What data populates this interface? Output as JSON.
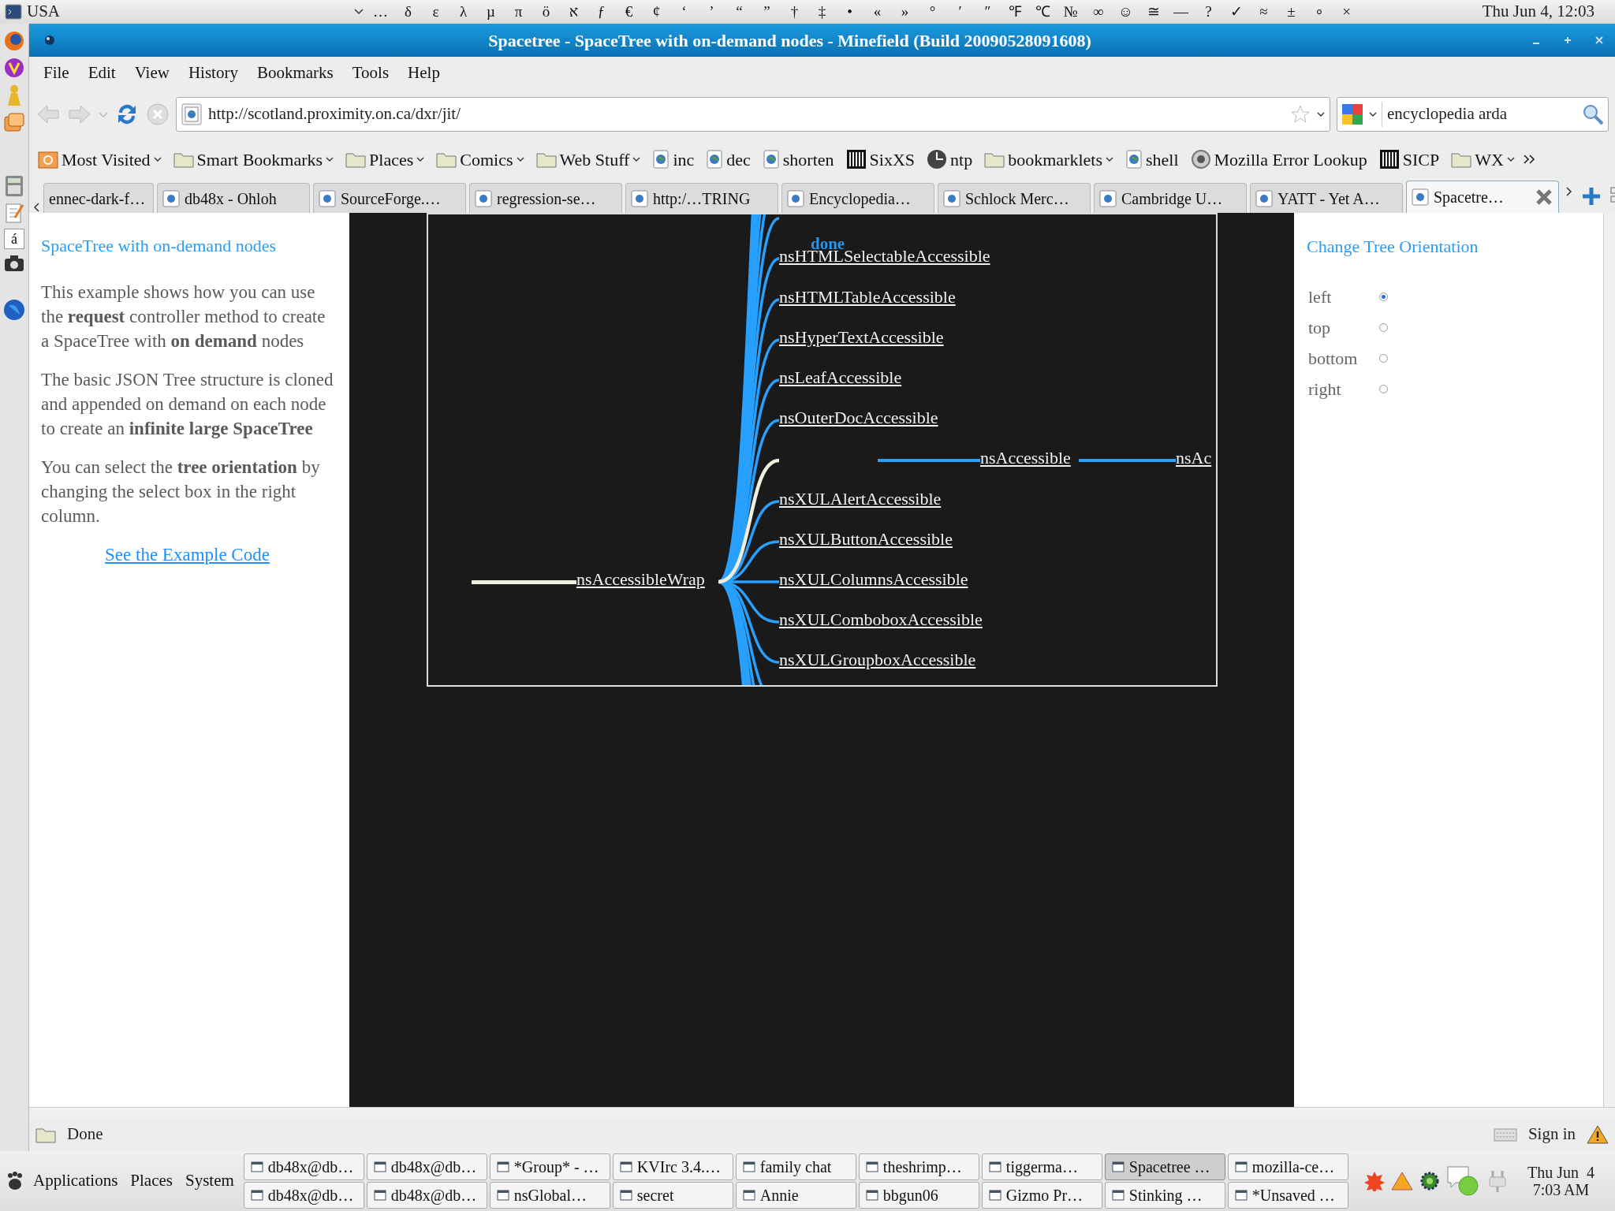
{
  "top_panel": {
    "keyboard_layout": "USA",
    "char_palette": [
      "…",
      "δ",
      "ε",
      "λ",
      "µ",
      "π",
      "ö",
      "א",
      "ƒ",
      "€",
      "¢",
      "‘",
      "’",
      "“",
      "”",
      "†",
      "‡",
      "•",
      "«",
      "»",
      "°",
      "′",
      "″",
      "℉",
      "℃",
      "№",
      "∞",
      "☺",
      "≅",
      "—",
      "?",
      "✓",
      "≈",
      "±",
      "∘",
      "×"
    ],
    "clock": "Thu Jun  4, 12:03"
  },
  "dock": {
    "glyph": "á"
  },
  "window": {
    "title": "Spacetree - SpaceTree with on-demand nodes - Minefield (Build 20090528091608)"
  },
  "menu": [
    "File",
    "Edit",
    "View",
    "History",
    "Bookmarks",
    "Tools",
    "Help"
  ],
  "navigation": {
    "url": "http://scotland.proximity.on.ca/dxr/jit/",
    "search": "encyclopedia arda"
  },
  "bookmarks": [
    {
      "label": "Most Visited",
      "kind": "smart",
      "dropdown": true
    },
    {
      "label": "Smart Bookmarks",
      "kind": "folder",
      "dropdown": true
    },
    {
      "label": "Places",
      "kind": "folder",
      "dropdown": true
    },
    {
      "label": "Comics",
      "kind": "folder",
      "dropdown": true
    },
    {
      "label": "Web Stuff",
      "kind": "folder",
      "dropdown": true
    },
    {
      "label": "inc",
      "kind": "page",
      "dropdown": false
    },
    {
      "label": "dec",
      "kind": "page",
      "dropdown": false
    },
    {
      "label": "shorten",
      "kind": "page",
      "dropdown": false
    },
    {
      "label": "SixXS",
      "kind": "bars",
      "dropdown": false
    },
    {
      "label": "ntp",
      "kind": "clock",
      "dropdown": false
    },
    {
      "label": "bookmarklets",
      "kind": "folder",
      "dropdown": true
    },
    {
      "label": "shell",
      "kind": "page",
      "dropdown": false
    },
    {
      "label": "Mozilla Error Lookup",
      "kind": "coin",
      "dropdown": false
    },
    {
      "label": "SICP",
      "kind": "bars",
      "dropdown": false
    },
    {
      "label": "WX",
      "kind": "folder",
      "dropdown": true
    }
  ],
  "tabs": [
    {
      "label": "ennec-dark-f…",
      "selected": false
    },
    {
      "label": "db48x - Ohloh",
      "selected": false
    },
    {
      "label": "SourceForge.…",
      "selected": false
    },
    {
      "label": "regression-se…",
      "selected": false
    },
    {
      "label": "http:/…TRING",
      "selected": false
    },
    {
      "label": "Encyclopedia…",
      "selected": false
    },
    {
      "label": "Schlock Merc…",
      "selected": false
    },
    {
      "label": "Cambridge U…",
      "selected": false
    },
    {
      "label": "YATT - Yet A…",
      "selected": false
    },
    {
      "label": "Spacetre…",
      "selected": true
    }
  ],
  "left_column": {
    "title": "SpaceTree with on-demand nodes",
    "paragraphs": [
      "This example shows how you can use the **request** controller method to create a SpaceTree with **on demand** nodes",
      "The basic JSON Tree structure is cloned and appended on demand on each node to create an **infinite large SpaceTree**",
      "You can select the **tree orientation** by changing the select box in the right column."
    ],
    "link": "See the Example Code"
  },
  "tree": {
    "status": "done",
    "root": {
      "label": "nsAccessibleWrap",
      "on_path": true,
      "children": [
        {
          "label": "nsHTMLSelectableAccessible",
          "on_path": false
        },
        {
          "label": "nsHTMLTableAccessible",
          "on_path": false
        },
        {
          "label": "nsHyperTextAccessible",
          "on_path": false
        },
        {
          "label": "nsLeafAccessible",
          "on_path": false
        },
        {
          "label": "nsOuterDocAccessible",
          "on_path": false
        },
        {
          "on_path": true,
          "children": [
            {
              "label": "nsAccessible",
              "on_path": false,
              "children": [
                {
                  "label": "nsAc",
                  "on_path": false
                }
              ]
            }
          ]
        },
        {
          "label": "nsXULAlertAccessible",
          "on_path": false
        },
        {
          "label": "nsXULButtonAccessible",
          "on_path": false
        },
        {
          "label": "nsXULColumnsAccessible",
          "on_path": false
        },
        {
          "label": "nsXULComboboxAccessible",
          "on_path": false
        },
        {
          "label": "nsXULGroupboxAccessible",
          "on_path": false
        }
      ]
    }
  },
  "right_column": {
    "title": "Change Tree Orientation",
    "options": [
      {
        "label": "left",
        "selected": true
      },
      {
        "label": "top",
        "selected": false
      },
      {
        "label": "bottom",
        "selected": false
      },
      {
        "label": "right",
        "selected": false
      }
    ]
  },
  "status_bar": {
    "text": "Done",
    "sign_in": "Sign in"
  },
  "bottom_panel": {
    "menus": [
      "Applications",
      "Places",
      "System"
    ],
    "tasks": [
      {
        "label": "db48x@db…",
        "selected": false
      },
      {
        "label": "db48x@db…",
        "selected": false
      },
      {
        "label": "*Group* - …",
        "selected": false
      },
      {
        "label": "KVIrc 3.4.…",
        "selected": false
      },
      {
        "label": "family chat",
        "selected": false
      },
      {
        "label": "theshrimp…",
        "selected": false
      },
      {
        "label": "tiggerma…",
        "selected": false
      },
      {
        "label": "Spacetree …",
        "selected": true
      },
      {
        "label": "mozilla-ce…",
        "selected": false
      },
      {
        "label": "db48x@db…",
        "selected": false
      },
      {
        "label": "db48x@db…",
        "selected": false
      },
      {
        "label": "nsGlobal…",
        "selected": false
      },
      {
        "label": "secret",
        "selected": false
      },
      {
        "label": "Annie",
        "selected": false
      },
      {
        "label": "bbgun06",
        "selected": false
      },
      {
        "label": "Gizmo Pr…",
        "selected": false
      },
      {
        "label": "Stinking …",
        "selected": false
      },
      {
        "label": "*Unsaved …",
        "selected": false
      }
    ],
    "clock_date": "Thu Jun  4",
    "clock_time": "7:03 AM"
  }
}
